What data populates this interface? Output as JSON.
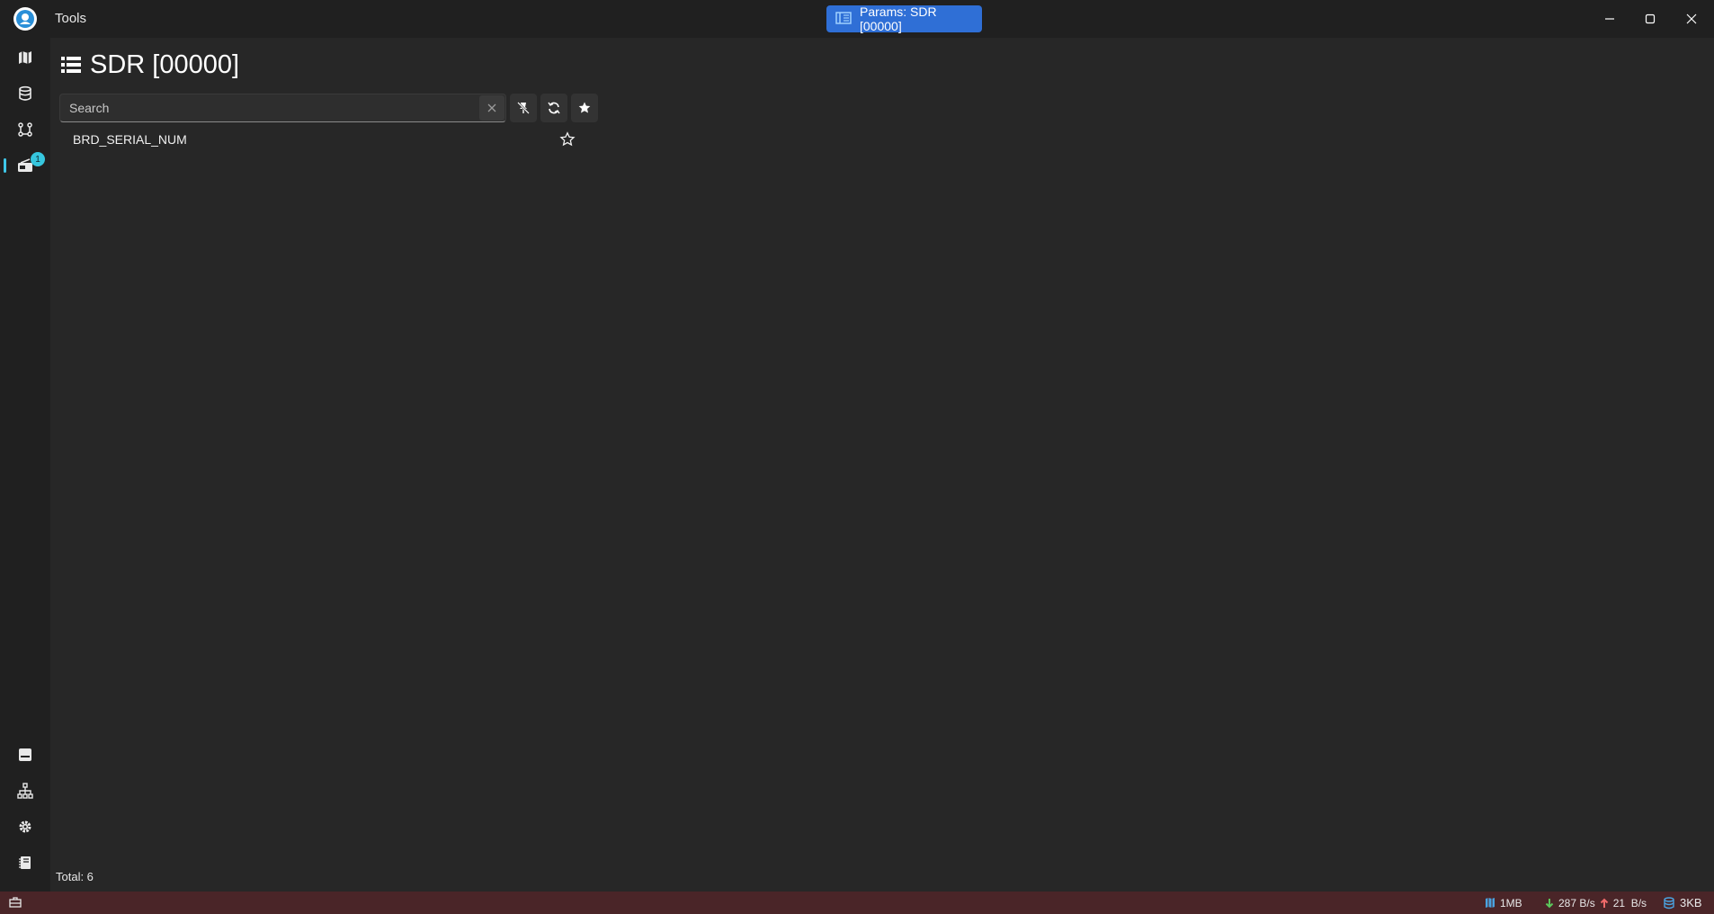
{
  "titlebar": {
    "app_title": "Tools",
    "active_tab_label": "Params: SDR [00000]",
    "icons": [
      "app-logo-icon",
      "params-tab-icon",
      "minimize-icon",
      "maximize-icon",
      "close-icon"
    ]
  },
  "sidebar": {
    "items": [
      {
        "name": "map-icon"
      },
      {
        "name": "database-icon"
      },
      {
        "name": "graph-icon"
      },
      {
        "name": "radio-icon",
        "active": true,
        "badge": "1"
      },
      {
        "name": "card-icon"
      },
      {
        "name": "network-icon"
      },
      {
        "name": "gear-icon"
      },
      {
        "name": "log-icon"
      }
    ],
    "accent": "#3ec7e8"
  },
  "page": {
    "title": "SDR [00000]",
    "search_placeholder": "Search",
    "search_value": "",
    "params": [
      {
        "name": "BRD_SERIAL_NUM",
        "favorite": false
      }
    ],
    "total_label": "Total: 6"
  },
  "statusbar": {
    "map_size": "1MB",
    "rx_rate": "287 B/s",
    "tx_rate": "21  B/s",
    "storage": "3KB",
    "color": "#4a2528"
  },
  "colors": {
    "tab_blue": "#2f6fd6",
    "background": "#272727",
    "chrome": "#202020"
  }
}
